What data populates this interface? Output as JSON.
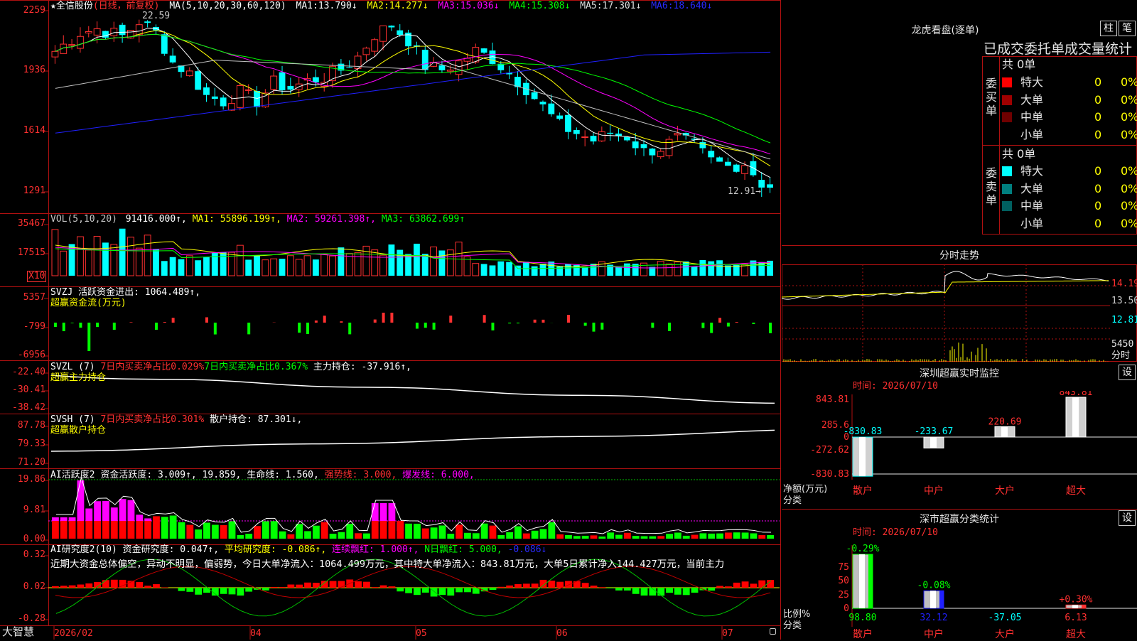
{
  "colors": {
    "up": "#ff3030",
    "down": "#00ffff",
    "ma1": "#ffffff",
    "ma2": "#ffff00",
    "ma3": "#ff00ff",
    "ma4": "#00ff00",
    "ma5": "#c0c0c0",
    "ma6": "#2020ff",
    "grid": "#b01010"
  },
  "main": {
    "title": "全信股份",
    "star": "★",
    "period": "(日线，前复权)",
    "ma_label": "MA(5,10,20,30,60,120)",
    "ma": [
      {
        "k": "MA1:",
        "v": "13.790↓"
      },
      {
        "k": "MA2:",
        "v": "14.277↓"
      },
      {
        "k": "MA3:",
        "v": "15.036↓"
      },
      {
        "k": "MA4:",
        "v": "15.308↓"
      },
      {
        "k": "MA5:",
        "v": "17.301↓"
      },
      {
        "k": "MA6:",
        "v": "18.640↓"
      }
    ],
    "high_mark": "22.59",
    "low_mark": "12.91→",
    "yticks": [
      "2259",
      "1936",
      "1614",
      "1291"
    ],
    "price_min": 12.2,
    "price_max": 23.2
  },
  "vol": {
    "label": "VOL(5,10,20)",
    "value": "91416.000↑",
    "ma1": "MA1: 55896.199↑",
    "ma2": "MA2: 59261.398↑",
    "ma3": "MA3: 63862.699↑",
    "yticks": [
      "35467",
      "17515"
    ],
    "unit": "X10"
  },
  "svzj": {
    "label": "SVZJ  活跃资金进出: 1064.489↑,",
    "sub": "超赢资金流(万元)",
    "yticks": [
      "5357",
      "-799",
      "-6956"
    ]
  },
  "svzl": {
    "label": "SVZL (7)",
    "a": "7日内买卖净占比0.029%",
    "b": "7日内买卖净占比0.367%",
    "c": "主力持仓: -37.916↑,",
    "sub": "超赢主力持仓",
    "yticks": [
      "-22.40",
      "-30.41",
      "-38.42"
    ]
  },
  "svsh": {
    "label": "SVSH (7)",
    "a": "7日内买卖净占比0.301%",
    "c": "散户持仓: 87.301↓,",
    "sub": "超赢散户持仓",
    "yticks": [
      "87.78",
      "79.33",
      "71.20"
    ]
  },
  "ai1": {
    "label": "AI活跃度2",
    "a": "资金活跃度: 3.009↑,",
    "b": "19.859,",
    "c": "生命线: 1.560,",
    "d": "强势线: 3.000,",
    "e": "爆发线: 6.000,",
    "yticks": [
      "19.86",
      "9.81",
      "0.00"
    ]
  },
  "ai2": {
    "label": "AI研究度2(10)",
    "a": "资金研究度: 0.047↑,",
    "b": "平均研究度: -0.086↑,",
    "c": "连续飘红: 1.000↑,",
    "d": "N日飘红: 5.000,",
    "e": "-0.086↓",
    "text": "近期大资金总体偏空，异动不明显，偏弱势，今日大单净流入：1064.499万元，其中特大单净流入：843.81万元，大单5日累计净入144.427万元，当前主力",
    "yticks": [
      "0.32",
      "0.02",
      "-0.28"
    ]
  },
  "xaxis": {
    "brand": "大智慧",
    "dates": [
      "2026/02",
      "04",
      "05",
      "06",
      "07"
    ]
  },
  "lhb": {
    "title": "龙虎看盘(逐单)",
    "btn1": "柱",
    "btn2": "笔",
    "sub": "已成交委托单成交量统计",
    "buy_side": "委买单",
    "sell_side": "委卖单",
    "buy_total": "共 0单",
    "sell_total": "共 0单",
    "buy_rows": [
      {
        "n": "特大",
        "c": "#ff0000",
        "q": "0",
        "p": "0%"
      },
      {
        "n": "大单",
        "c": "#a00000",
        "q": "0",
        "p": "0%"
      },
      {
        "n": "中单",
        "c": "#700000",
        "q": "0",
        "p": "0%"
      },
      {
        "n": "小单",
        "c": "",
        "q": "0",
        "p": "0%"
      }
    ],
    "sell_rows": [
      {
        "n": "特大",
        "c": "#00ffff",
        "q": "0",
        "p": "0%"
      },
      {
        "n": "大单",
        "c": "#008080",
        "q": "0",
        "p": "0%"
      },
      {
        "n": "中单",
        "c": "#006060",
        "q": "0",
        "p": "0%"
      },
      {
        "n": "小单",
        "c": "",
        "q": "0",
        "p": "0%"
      }
    ]
  },
  "fenshi": {
    "title": "分时走势",
    "yticks": [
      "14.19",
      "13.50",
      "12.81"
    ],
    "vol_tick": "5450",
    "vol_unit": "分时"
  },
  "monitor": {
    "title": "深圳超赢实时监控",
    "btn": "设",
    "time": "时间: 2026/07/10",
    "yticks": [
      "843.81",
      "285.6",
      "0",
      "-272.62",
      "-830.83"
    ],
    "bars": [
      {
        "name": "散户",
        "value": -830.83,
        "label": "-830.83"
      },
      {
        "name": "中户",
        "value": -233.67,
        "label": "-233.67"
      },
      {
        "name": "大户",
        "value": 220.69,
        "label": "220.69"
      },
      {
        "name": "超大",
        "value": 843.81,
        "label": "843.81"
      }
    ],
    "yname1": "净额(万元)",
    "yname2": "分类"
  },
  "classify": {
    "title": "深市超赢分类统计",
    "btn": "设",
    "time": "时间: 2026/07/10",
    "yticks": [
      "75",
      "50",
      "25",
      "0"
    ],
    "bars": [
      {
        "name": "散户",
        "pct": "-0.29%",
        "value": 98.8,
        "label": "98.80"
      },
      {
        "name": "中户",
        "pct": "-0.08%",
        "value": 32.12,
        "label": "32.12"
      },
      {
        "name": "大户",
        "pct": "",
        "value": -37.05,
        "label": "-37.05"
      },
      {
        "name": "超大",
        "pct": "+0.30%",
        "value": 6.13,
        "label": "6.13"
      }
    ],
    "yname1": "比例%",
    "yname2": "分类"
  }
}
